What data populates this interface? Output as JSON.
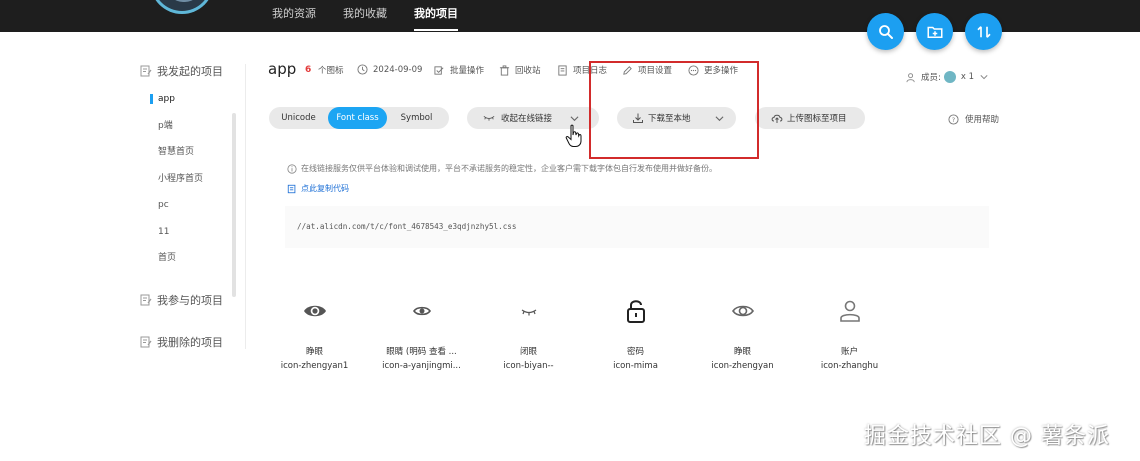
{
  "topnav": {
    "items": [
      "我的资源",
      "我的收藏",
      "我的项目"
    ],
    "active": 2
  },
  "fab": {
    "search": "search-icon",
    "add_folder": "folder-plus-icon",
    "sort": "sort-icon"
  },
  "sidebar": {
    "started_title": "我发起的项目",
    "started_items": [
      "app",
      "p端",
      "智慧首页",
      "小程序首页",
      "pc",
      "11",
      "首页"
    ],
    "joined_title": "我参与的项目",
    "deleted_title": "我删除的项目"
  },
  "project": {
    "title": "app",
    "icon_count": "6",
    "icon_count_suffix": "个图标",
    "date": "2024-09-09",
    "batch": "批量操作",
    "recycle": "回收站",
    "log": "项目日志",
    "settings": "项目设置",
    "more": "更多操作",
    "members_label": "成员:",
    "members_count": "x 1"
  },
  "toolbar": {
    "modes": [
      "Unicode",
      "Font class",
      "Symbol"
    ],
    "active_mode": "Font class",
    "collapse_link": "收起在线链接",
    "download": "下载至本地",
    "upload": "上传图标至项目",
    "help": "使用帮助"
  },
  "notice": "在线链接服务仅供平台体验和调试使用，平台不承诺服务的稳定性，企业客户需下载字体包自行发布使用并做好备份。",
  "copy_code": "点此复制代码",
  "css_link": "//at.alicdn.com/t/c/font_4678543_e3qdjnzhy5l.css",
  "icons": [
    {
      "name": "睁眼",
      "code": "icon-zhengyan1",
      "glyph": "eye-open-icon"
    },
    {
      "name": "眼睛 (明码 查看 ...",
      "code": "icon-a-yanjingmi...",
      "glyph": "eye-icon"
    },
    {
      "name": "闭眼",
      "code": "icon-biyan--",
      "glyph": "eye-closed-icon"
    },
    {
      "name": "密码",
      "code": "icon-mima",
      "glyph": "lock-icon"
    },
    {
      "name": "睁眼",
      "code": "icon-zhengyan",
      "glyph": "eye-outline-icon"
    },
    {
      "name": "账户",
      "code": "icon-zhanghu",
      "glyph": "user-icon"
    }
  ],
  "watermark": "掘金技术社区 @ 薯条派",
  "colors": {
    "accent": "#1c9ff1",
    "highlight": "#d22b2b",
    "count": "#e33a3a"
  }
}
